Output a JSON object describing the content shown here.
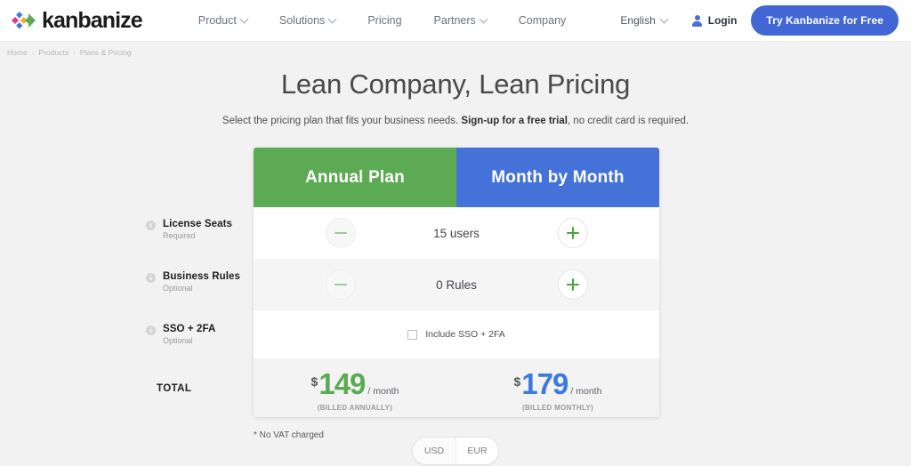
{
  "header": {
    "logo_text": "kanbanize",
    "nav": [
      {
        "label": "Product",
        "caret": true
      },
      {
        "label": "Solutions",
        "caret": true
      },
      {
        "label": "Pricing",
        "caret": false
      },
      {
        "label": "Partners",
        "caret": true
      },
      {
        "label": "Company",
        "caret": false
      }
    ],
    "language": "English",
    "login": "Login",
    "cta": "Try Kanbanize for Free",
    "accent_blue": "#4267d4"
  },
  "breadcrumb": {
    "items": [
      "Home",
      "Products",
      "Plans & Pricing"
    ],
    "separator": "›"
  },
  "hero": {
    "title": "Lean Company, Lean Pricing",
    "sub_before": "Select the pricing plan that fits your business needs. ",
    "sub_bold": "Sign-up for a free trial",
    "sub_after": ", no credit card is required."
  },
  "features": [
    {
      "title": "License Seats",
      "sub": "Required",
      "icon": "info-icon"
    },
    {
      "title": "Business Rules",
      "sub": "Optional",
      "icon": "info-icon"
    },
    {
      "title": "SSO + 2FA",
      "sub": "Optional",
      "icon": "info-icon"
    }
  ],
  "total_label": "TOTAL",
  "card": {
    "tabs": [
      {
        "label": "Annual Plan",
        "color": "#5caa53"
      },
      {
        "label": "Month by Month",
        "color": "#4572d8"
      }
    ],
    "rows": [
      {
        "value": "15 users",
        "minus": "minus-icon",
        "plus": "plus-icon"
      },
      {
        "value": "0 Rules",
        "minus": "minus-icon",
        "plus": "plus-icon"
      }
    ],
    "sso": {
      "label": "Include SSO + 2FA",
      "checked": false
    },
    "totals": [
      {
        "currency_symbol": "$",
        "amount": "149",
        "period": "/ month",
        "billed": "(BILLED ANNUALLY)",
        "color": "#5caa53"
      },
      {
        "currency_symbol": "$",
        "amount": "179",
        "period": "/ month",
        "billed": "(BILLED MONTHLY)",
        "color": "#3d7ae0"
      }
    ]
  },
  "vat_note": "* No VAT charged",
  "currency_toggle": {
    "options": [
      "USD",
      "EUR"
    ],
    "selected": "EUR"
  }
}
